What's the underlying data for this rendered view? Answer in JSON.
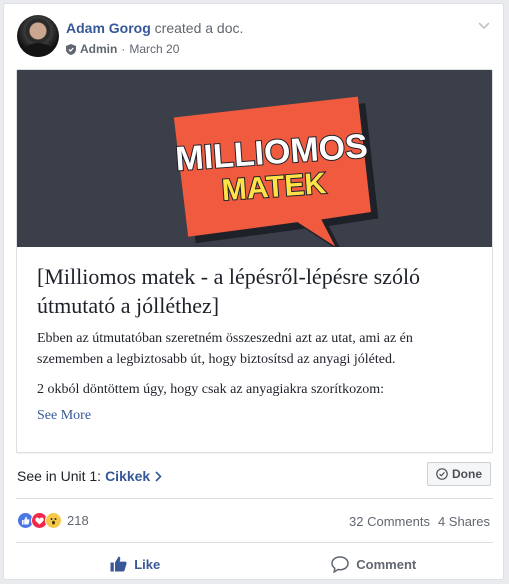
{
  "post": {
    "author_name": "Adam Gorog",
    "action_text": "created a doc.",
    "role_label": "Admin",
    "separator": "·",
    "date": "March 20"
  },
  "doc": {
    "banner_line1": "MILLIOMOS",
    "banner_line2": "MATEK",
    "title_line1": "[Milliomos matek - a lépésről-lépésre szóló",
    "title_line2": "útmutató a jólléthez]",
    "paragraph1": "Ebben az útmutatóban szeretném összeszedni azt az utat, ami az én szememben a legbiztosabb út, hogy biztosítsd az anyagi jóléted.",
    "paragraph2": "2 okból döntöttem úgy, hogy csak az anyagiakra szorítkozom:",
    "see_more": "See More"
  },
  "unit": {
    "prefix": "See in Unit 1:",
    "link": "Cikkek",
    "done_label": "Done"
  },
  "engagement": {
    "reaction_count": "218",
    "comments": "32 Comments",
    "shares": "4 Shares"
  },
  "actions": {
    "like_label": "Like",
    "comment_label": "Comment"
  },
  "colors": {
    "banner_bg": "#3b3f4a",
    "bubble": "#f05a3f",
    "bubble_shadow": "#1f2128",
    "banner_text_white": "#ffffff",
    "banner_text_yellow": "#ffe24a",
    "link_blue": "#365899"
  },
  "icons": [
    "chevron-down-icon",
    "shield-icon",
    "check-circle-icon",
    "like-reaction-icon",
    "love-reaction-icon",
    "wow-reaction-icon",
    "thumbs-up-icon",
    "comment-icon",
    "chevron-right-icon"
  ]
}
